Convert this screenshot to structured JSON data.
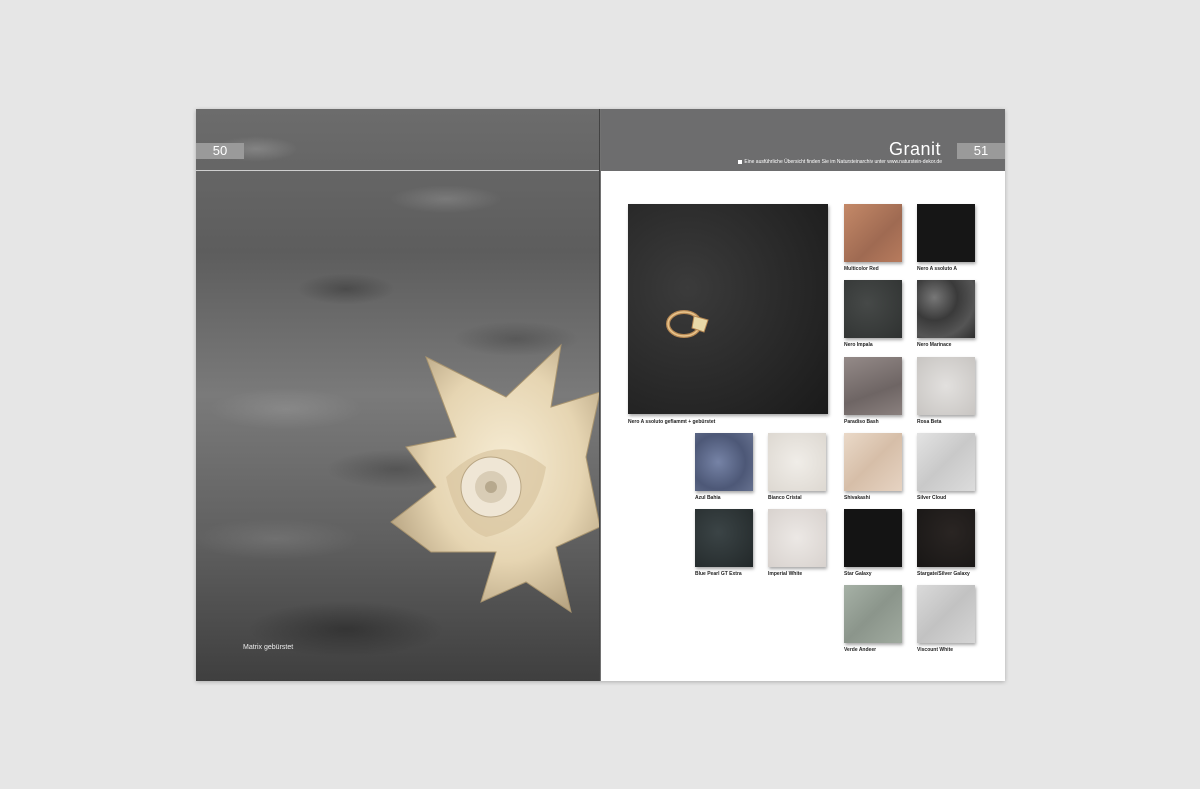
{
  "left_page": {
    "page_number": "50",
    "photo_caption": "Matrix gebürstet"
  },
  "right_page": {
    "page_number": "51",
    "title": "Granit",
    "subline": "Eine ausführliche Übersicht finden Sie im Natursteinarchiv unter www.naturstein-dekor.de",
    "hero_caption": "Nero A ssoluto geflammt + gebürstet",
    "swatches": [
      {
        "label": "Multicolor Red",
        "color": "#b77b5d"
      },
      {
        "label": "Nero A ssoluto A",
        "color": "#161616"
      },
      {
        "label": "Nero Impala",
        "color": "#3a3d3c"
      },
      {
        "label": "Nero Marinace",
        "color": "#4a4a4a"
      },
      {
        "label": "Paradiso Bash",
        "color": "#837b7a"
      },
      {
        "label": "Rosa Beta",
        "color": "#d7d5d3"
      },
      {
        "label": "Azul Bahia",
        "color": "#5e6a8c"
      },
      {
        "label": "Bianco Cristal",
        "color": "#eae7e2"
      },
      {
        "label": "Shivakashi",
        "color": "#e2cfbe"
      },
      {
        "label": "Silver Cloud",
        "color": "#d9d9d9"
      },
      {
        "label": "Blue Pearl GT Extra",
        "color": "#2b3233"
      },
      {
        "label": "Imperial White",
        "color": "#e5e0dd"
      },
      {
        "label": "Star Galaxy",
        "color": "#141414"
      },
      {
        "label": "Stargate/Silver Galaxy",
        "color": "#1f1c1b"
      },
      {
        "label": "Verde Andeer",
        "color": "#9aa59a"
      },
      {
        "label": "Viscount White",
        "color": "#d1d1d1"
      }
    ]
  }
}
